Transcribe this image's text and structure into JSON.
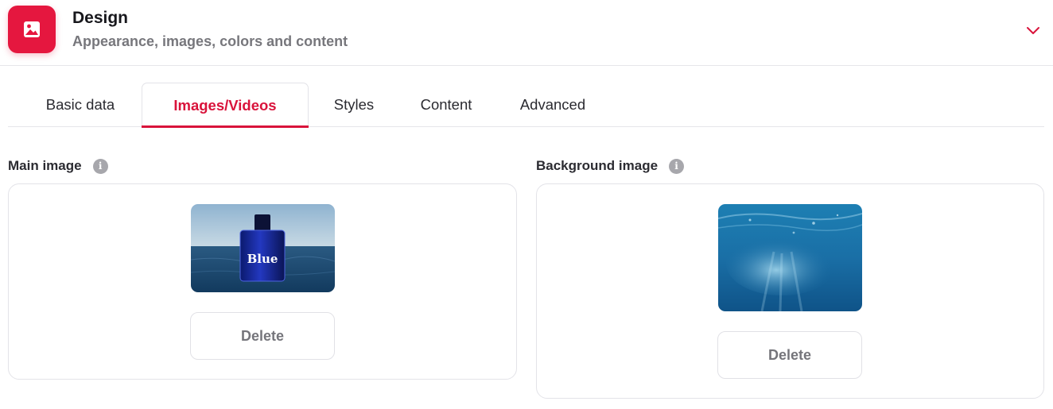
{
  "header": {
    "title": "Design",
    "subtitle": "Appearance, images, colors and content",
    "icon": "image-icon",
    "accent_color": "#e5173f"
  },
  "tabs": [
    {
      "label": "Basic data",
      "active": false
    },
    {
      "label": "Images/Videos",
      "active": true
    },
    {
      "label": "Styles",
      "active": false
    },
    {
      "label": "Content",
      "active": false
    },
    {
      "label": "Advanced",
      "active": false
    }
  ],
  "main_image": {
    "label": "Main image",
    "info_icon": "info-icon",
    "bottle_text": "Blue",
    "delete_label": "Delete"
  },
  "background_image": {
    "label": "Background image",
    "info_icon": "info-icon",
    "delete_label": "Delete"
  }
}
